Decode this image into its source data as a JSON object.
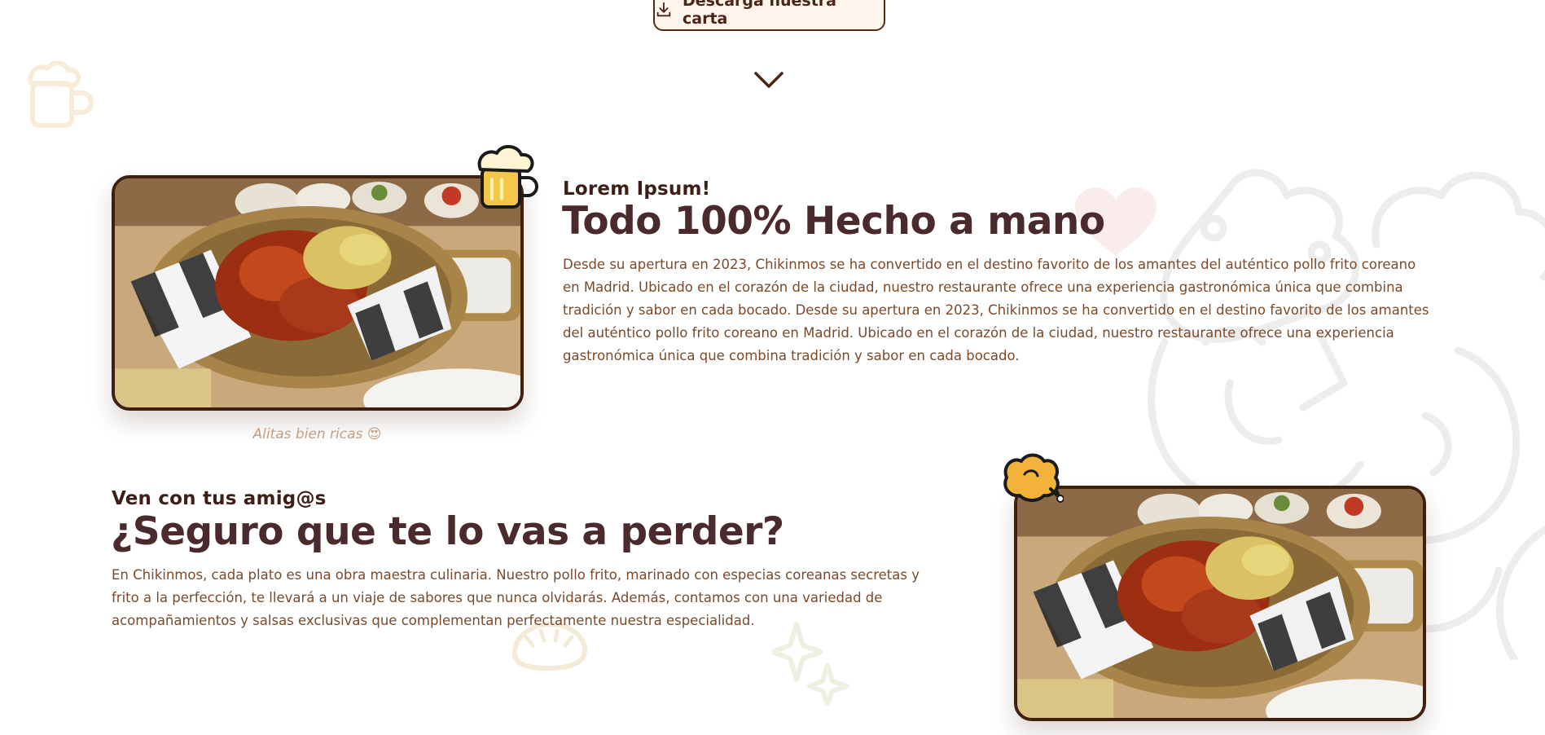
{
  "download_button": {
    "label": "Descarga nuestra carta",
    "icon": "download-icon"
  },
  "scroll_indicator": {
    "icon": "chevron-down-icon"
  },
  "section_handmade": {
    "kicker": "Lorem Ipsum!",
    "title": "Todo 100% Hecho a mano",
    "body": "Desde su apertura en 2023, Chikinmos se ha convertido en el destino favorito de los amantes del auténtico pollo frito coreano en Madrid. Ubicado en el corazón de la ciudad, nuestro restaurante ofrece una experiencia gastronómica única que combina tradición y sabor en cada bocado. Desde su apertura en 2023, Chikinmos se ha convertido en el destino favorito de los amantes del auténtico pollo frito coreano en Madrid. Ubicado en el corazón de la ciudad, nuestro restaurante ofrece una experiencia gastronómica única que combina tradición y sabor en cada bocado.",
    "image_caption": "Alitas bien ricas 😍",
    "sticker_icon": "beer-mug-icon"
  },
  "section_friends": {
    "kicker": "Ven con tus amig@s",
    "title": "¿Seguro que te lo vas a perder?",
    "body": "En Chikinmos, cada plato es una obra maestra culinaria. Nuestro pollo frito, marinado con especias coreanas secretas y frito a la perfección, te llevará a un viaje de sabores que nunca olvidarás. Además, contamos con una variedad de acompañamientos y salsas exclusivas que complementan perfectamente nuestra especialidad.",
    "sticker_icon": "fried-chicken-icon"
  },
  "colors": {
    "brand_dark": "#3e1f10",
    "heading": "#4a2a2c",
    "body": "#7a4a2a",
    "button_bg": "#fdf5ec",
    "caption": "#c29f84"
  }
}
